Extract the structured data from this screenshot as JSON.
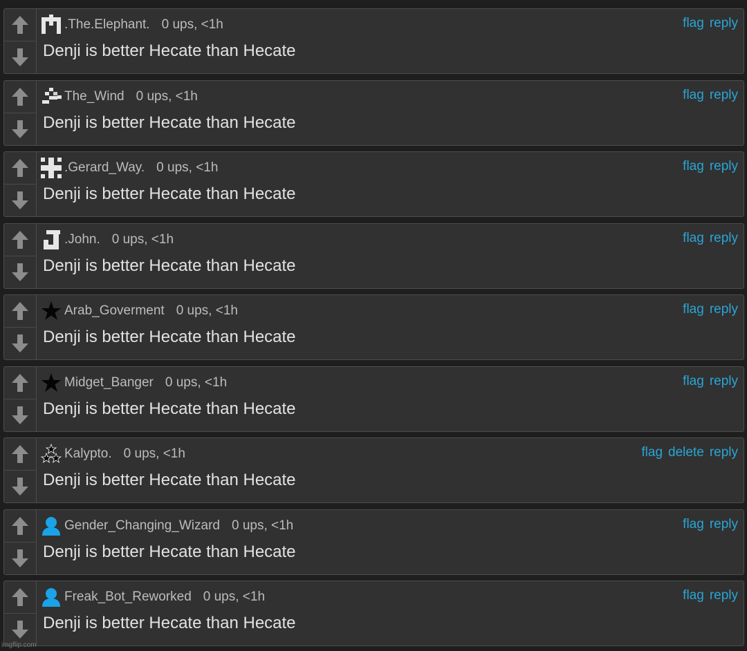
{
  "colors": {
    "background": "#1e1e1e",
    "card": "#313131",
    "border": "#4d4d4d",
    "link": "#2aa5d6",
    "meta_text": "#bcbcbc",
    "body_text": "#e2e2e2",
    "arrow": "#8c8c8c"
  },
  "comments": [
    {
      "username": ".The.Elephant.",
      "stats": "0 ups, <1h",
      "avatar_icon": "pixel-m-avatar-icon",
      "text": "Denji is better Hecate than Hecate",
      "actions": [
        "flag",
        "reply"
      ]
    },
    {
      "username": "The_Wind",
      "stats": "0 ups, <1h",
      "avatar_icon": "pixel-wind-avatar-icon",
      "text": "Denji is better Hecate than Hecate",
      "actions": [
        "flag",
        "reply"
      ]
    },
    {
      "username": ".Gerard_Way.",
      "stats": "0 ups, <1h",
      "avatar_icon": "pixel-cross-avatar-icon",
      "text": "Denji is better Hecate than Hecate",
      "actions": [
        "flag",
        "reply"
      ]
    },
    {
      "username": ".John.",
      "stats": "0 ups, <1h",
      "avatar_icon": "pixel-j-avatar-icon",
      "text": "Denji is better Hecate than Hecate",
      "actions": [
        "flag",
        "reply"
      ]
    },
    {
      "username": "Arab_Goverment",
      "stats": "0 ups, <1h",
      "avatar_icon": "black-star-avatar-icon",
      "text": "Denji is better Hecate than Hecate",
      "actions": [
        "flag",
        "reply"
      ]
    },
    {
      "username": "Midget_Banger",
      "stats": "0 ups, <1h",
      "avatar_icon": "black-star-avatar-icon",
      "text": "Denji is better Hecate than Hecate",
      "actions": [
        "flag",
        "reply"
      ]
    },
    {
      "username": "Kalypto.",
      "stats": "0 ups, <1h",
      "avatar_icon": "three-stars-avatar-icon",
      "text": "Denji is better Hecate than Hecate",
      "actions": [
        "flag",
        "delete",
        "reply"
      ]
    },
    {
      "username": "Gender_Changing_Wizard",
      "stats": "0 ups, <1h",
      "avatar_icon": "default-user-avatar-icon",
      "text": "Denji is better Hecate than Hecate",
      "actions": [
        "flag",
        "reply"
      ]
    },
    {
      "username": "Freak_Bot_Reworked",
      "stats": "0 ups, <1h",
      "avatar_icon": "default-user-avatar-icon",
      "text": "Denji is better Hecate than Hecate",
      "actions": [
        "flag",
        "reply"
      ]
    }
  ],
  "watermark": "imgflip.com"
}
